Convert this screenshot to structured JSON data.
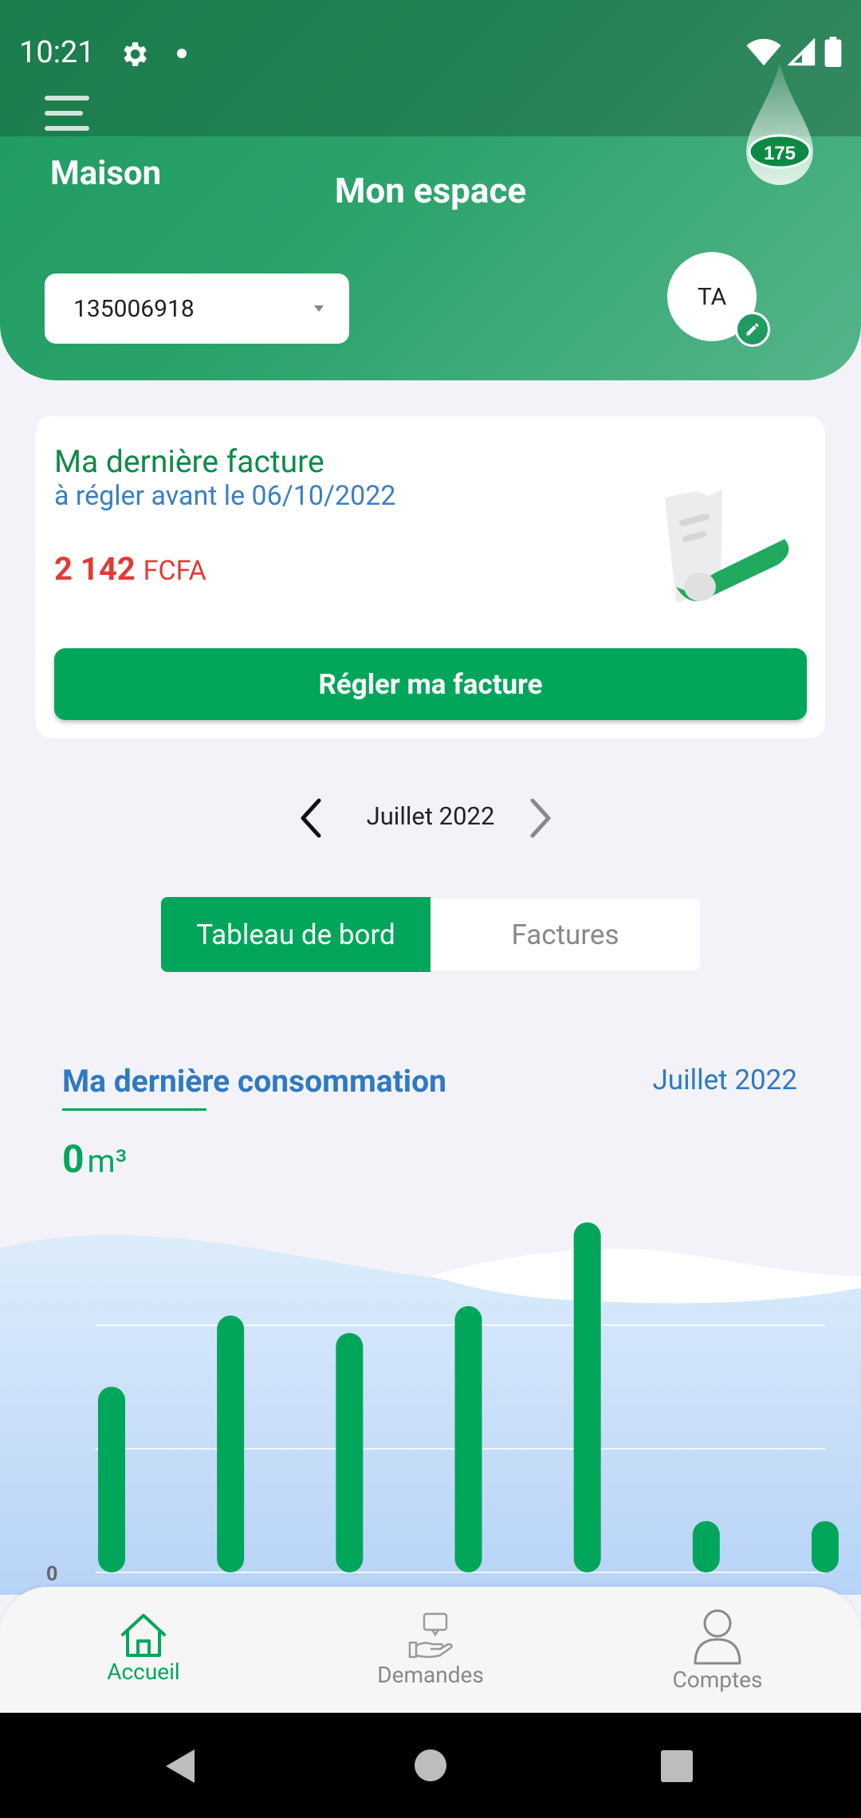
{
  "status_bar": {
    "time": "10:21"
  },
  "header": {
    "left_label": "Maison",
    "title": "Mon espace",
    "logo_text": "175",
    "account_number": "135006918",
    "avatar_initials": "TA"
  },
  "invoice_card": {
    "title": "Ma dernière facture",
    "due_text": "à régler avant le 06/10/2022",
    "amount": "2 142",
    "currency": "FCFA",
    "pay_button": "Régler ma facture"
  },
  "month_nav": {
    "label": "Juillet 2022"
  },
  "tabs": [
    {
      "label": "Tableau de bord",
      "active": true
    },
    {
      "label": "Factures",
      "active": false
    }
  ],
  "consumption": {
    "title": "Ma dernière consommation",
    "month": "Juillet 2022",
    "value": "0",
    "unit": "m³"
  },
  "chart_data": {
    "type": "bar",
    "y_tick_labels": [
      "0"
    ],
    "values": [
      235,
      325,
      303,
      337,
      443,
      65,
      65
    ],
    "ylim": [
      0,
      450
    ],
    "bar_color": "#02a65a"
  },
  "bottom_nav": [
    {
      "label": "Accueil",
      "icon": "home-icon",
      "active": true
    },
    {
      "label": "Demandes",
      "icon": "requests-icon",
      "active": false
    },
    {
      "label": "Comptes",
      "icon": "account-icon",
      "active": false
    }
  ],
  "colors": {
    "primary": "#02a65a",
    "accent_blue": "#2f7ac0",
    "amount_red": "#e53935"
  }
}
